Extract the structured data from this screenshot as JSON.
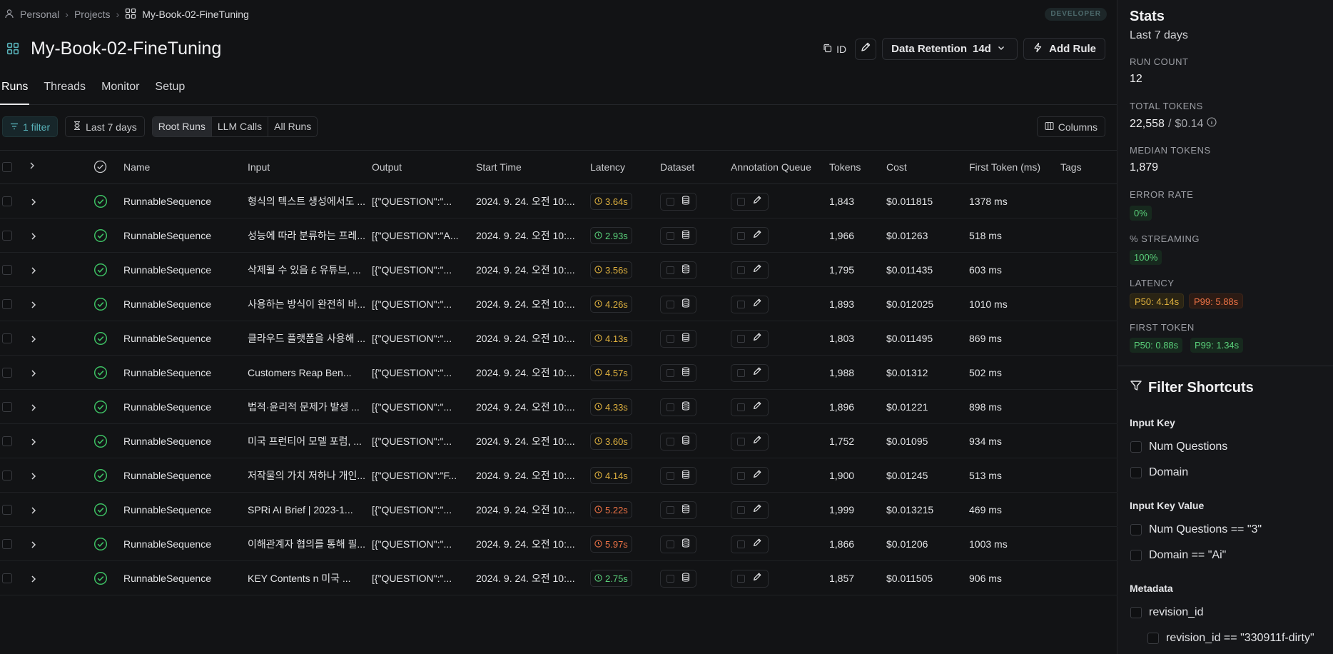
{
  "breadcrumb": {
    "items": [
      "Personal",
      "Projects",
      "My-Book-02-FineTuning"
    ],
    "badge": "DEVELOPER"
  },
  "project": {
    "title": "My-Book-02-FineTuning",
    "id_label": "ID",
    "retention_label": "Data Retention",
    "retention_value": "14d",
    "add_rule_label": "Add Rule"
  },
  "tabs": [
    "Runs",
    "Threads",
    "Monitor",
    "Setup"
  ],
  "filters": {
    "filter_label": "1 filter",
    "time_label": "Last 7 days",
    "run_types": [
      "Root Runs",
      "LLM Calls",
      "All Runs"
    ],
    "columns_label": "Columns"
  },
  "table": {
    "headers": {
      "name": "Name",
      "input": "Input",
      "output": "Output",
      "start_time": "Start Time",
      "latency": "Latency",
      "dataset": "Dataset",
      "annotation_queue": "Annotation Queue",
      "tokens": "Tokens",
      "cost": "Cost",
      "first_token": "First Token (ms)",
      "tags": "Tags"
    },
    "rows": [
      {
        "name": "RunnableSequence",
        "input": "형식의 텍스트 생성에서도 ...",
        "output": "[{\"QUESTION\":\"...",
        "start": "2024. 9. 24. 오전 10:...",
        "latency": "3.64s",
        "lat_status": "warn",
        "tokens": "1,843",
        "cost": "$0.011815",
        "first": "1378 ms"
      },
      {
        "name": "RunnableSequence",
        "input": "성능에 따라 분류하는 프레...",
        "output": "[{\"QUESTION\":\"A...",
        "start": "2024. 9. 24. 오전 10:...",
        "latency": "2.93s",
        "lat_status": "ok",
        "tokens": "1,966",
        "cost": "$0.01263",
        "first": "518 ms"
      },
      {
        "name": "RunnableSequence",
        "input": "삭제될 수 있음 £ 유튜브, ...",
        "output": "[{\"QUESTION\":\"...",
        "start": "2024. 9. 24. 오전 10:...",
        "latency": "3.56s",
        "lat_status": "warn",
        "tokens": "1,795",
        "cost": "$0.011435",
        "first": "603 ms"
      },
      {
        "name": "RunnableSequence",
        "input": "사용하는 방식이 완전히 바...",
        "output": "[{\"QUESTION\":\"...",
        "start": "2024. 9. 24. 오전 10:...",
        "latency": "4.26s",
        "lat_status": "warn",
        "tokens": "1,893",
        "cost": "$0.012025",
        "first": "1010 ms"
      },
      {
        "name": "RunnableSequence",
        "input": "클라우드 플랫폼을 사용해 ...",
        "output": "[{\"QUESTION\":\"...",
        "start": "2024. 9. 24. 오전 10:...",
        "latency": "4.13s",
        "lat_status": "warn",
        "tokens": "1,803",
        "cost": "$0.011495",
        "first": "869 ms"
      },
      {
        "name": "RunnableSequence",
        "input": "Customers Reap Ben...",
        "output": "[{\"QUESTION\":\"...",
        "start": "2024. 9. 24. 오전 10:...",
        "latency": "4.57s",
        "lat_status": "warn",
        "tokens": "1,988",
        "cost": "$0.01312",
        "first": "502 ms"
      },
      {
        "name": "RunnableSequence",
        "input": "법적·윤리적 문제가 발생 ...",
        "output": "[{\"QUESTION\":\"...",
        "start": "2024. 9. 24. 오전 10:...",
        "latency": "4.33s",
        "lat_status": "warn",
        "tokens": "1,896",
        "cost": "$0.01221",
        "first": "898 ms"
      },
      {
        "name": "RunnableSequence",
        "input": "미국 프런티어 모델 포럼, ...",
        "output": "[{\"QUESTION\":\"...",
        "start": "2024. 9. 24. 오전 10:...",
        "latency": "3.60s",
        "lat_status": "warn",
        "tokens": "1,752",
        "cost": "$0.01095",
        "first": "934 ms"
      },
      {
        "name": "RunnableSequence",
        "input": "저작물의 가치 저하나 개인...",
        "output": "[{\"QUESTION\":\"F...",
        "start": "2024. 9. 24. 오전 10:...",
        "latency": "4.14s",
        "lat_status": "warn",
        "tokens": "1,900",
        "cost": "$0.01245",
        "first": "513 ms"
      },
      {
        "name": "RunnableSequence",
        "input": "SPRi AI Brief | 2023-1...",
        "output": "[{\"QUESTION\":\"...",
        "start": "2024. 9. 24. 오전 10:...",
        "latency": "5.22s",
        "lat_status": "bad",
        "tokens": "1,999",
        "cost": "$0.013215",
        "first": "469 ms"
      },
      {
        "name": "RunnableSequence",
        "input": "이해관계자 협의를 통해 필...",
        "output": "[{\"QUESTION\":\"...",
        "start": "2024. 9. 24. 오전 10:...",
        "latency": "5.97s",
        "lat_status": "bad",
        "tokens": "1,866",
        "cost": "$0.01206",
        "first": "1003 ms"
      },
      {
        "name": "RunnableSequence",
        "input": "KEY Contents n 미국 ...",
        "output": "[{\"QUESTION\":\"...",
        "start": "2024. 9. 24. 오전 10:...",
        "latency": "2.75s",
        "lat_status": "ok",
        "tokens": "1,857",
        "cost": "$0.011505",
        "first": "906 ms"
      }
    ]
  },
  "stats": {
    "title": "Stats",
    "period": "Last 7 days",
    "run_count_label": "RUN COUNT",
    "run_count": "12",
    "total_tokens_label": "TOTAL TOKENS",
    "total_tokens": "22,558",
    "total_cost": "$0.14",
    "median_tokens_label": "MEDIAN TOKENS",
    "median_tokens": "1,879",
    "error_rate_label": "ERROR RATE",
    "error_rate": "0%",
    "streaming_label": "% STREAMING",
    "streaming": "100%",
    "latency_label": "LATENCY",
    "latency_p50": "P50: 4.14s",
    "latency_p99": "P99: 5.88s",
    "first_token_label": "FIRST TOKEN",
    "first_token_p50": "P50: 0.88s",
    "first_token_p99": "P99: 1.34s"
  },
  "filter_shortcuts": {
    "title": "Filter Shortcuts",
    "input_key_label": "Input Key",
    "input_key_items": [
      "Num Questions",
      "Domain"
    ],
    "input_key_value_label": "Input Key Value",
    "input_key_value_items": [
      "Num Questions == \"3\"",
      "Domain == \"Ai\""
    ],
    "metadata_label": "Metadata",
    "metadata_items": [
      "revision_id"
    ],
    "metadata_sub_items": [
      "revision_id == \"330911f-dirty\""
    ]
  },
  "colors": {
    "accent": "#58b3ba",
    "ok": "#5ad07a",
    "warn": "#e0b23f",
    "bad": "#ef7346"
  }
}
